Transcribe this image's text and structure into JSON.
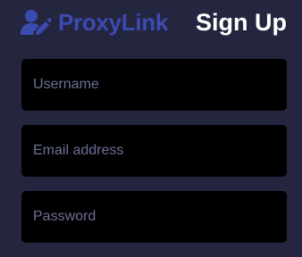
{
  "brand": {
    "name": "ProxyLink",
    "color": "#3c4bb0"
  },
  "page": {
    "title": "Sign Up",
    "background": "#242640"
  },
  "form": {
    "username": {
      "placeholder": "Username",
      "value": ""
    },
    "email": {
      "placeholder": "Email address",
      "value": ""
    },
    "password": {
      "placeholder": "Password",
      "value": ""
    }
  },
  "icons": {
    "brand_icon": "user-edit-icon"
  }
}
